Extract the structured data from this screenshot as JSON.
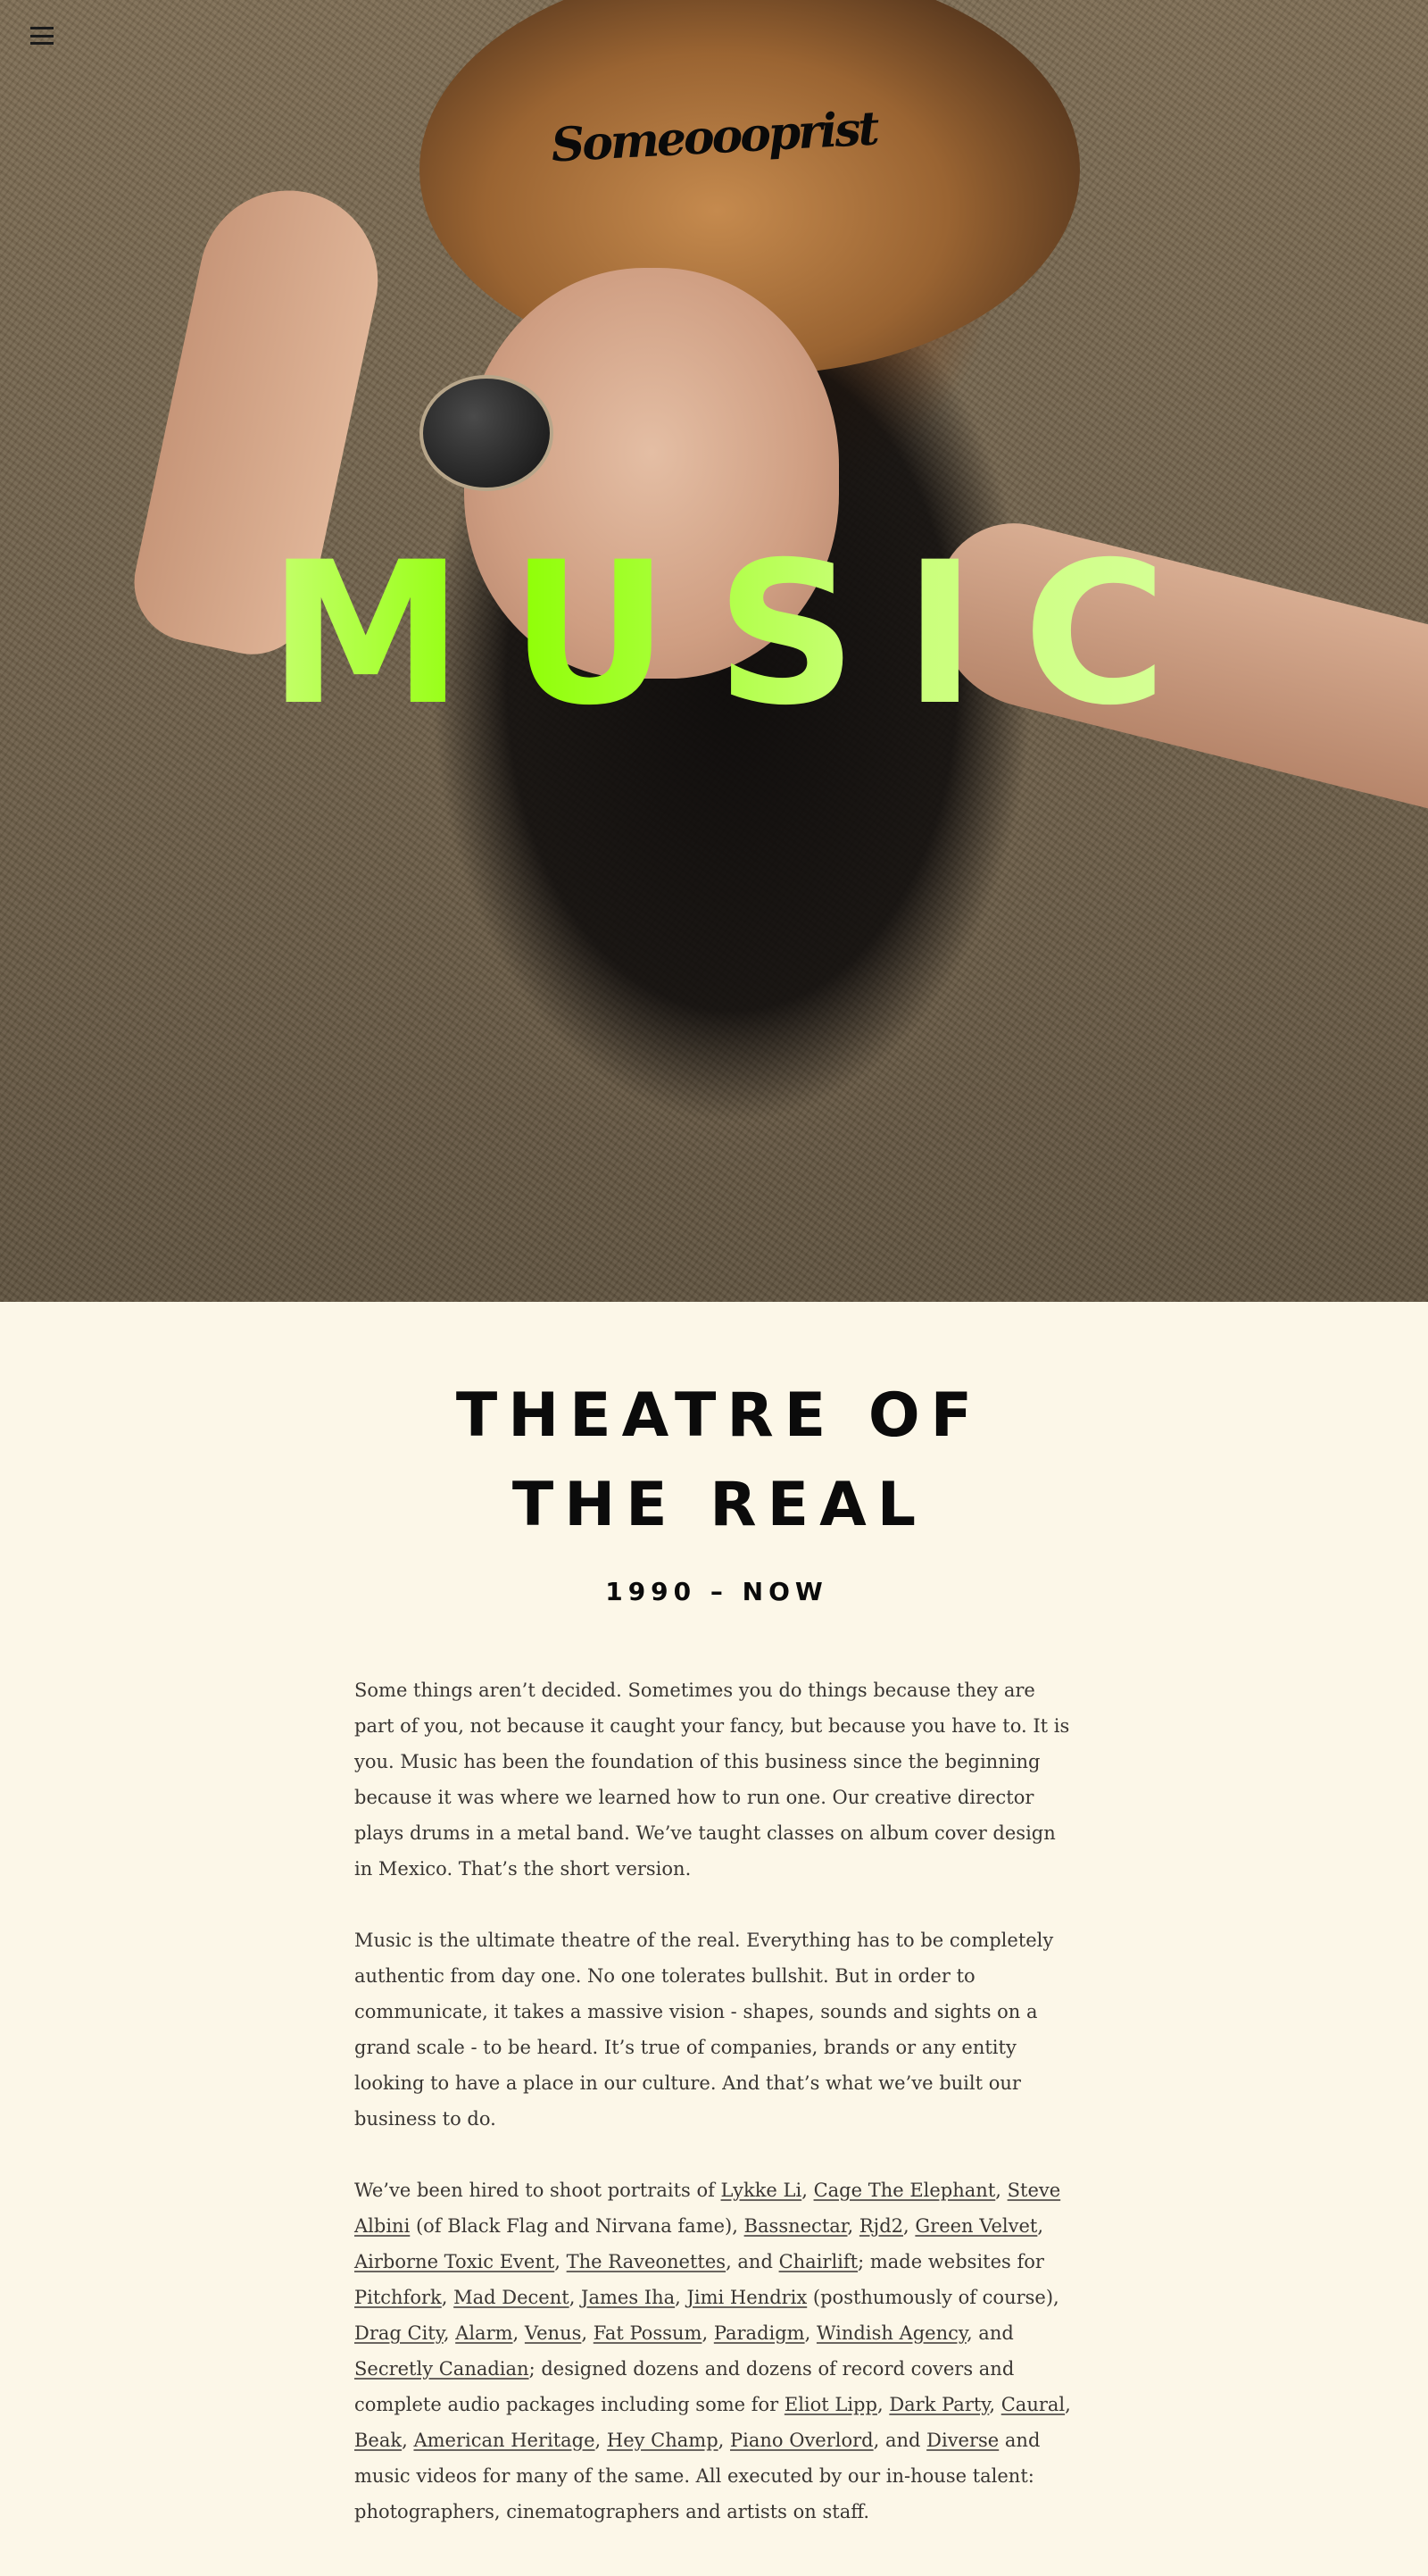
{
  "hero": {
    "logo_text": "Someoooprist",
    "title": "MUSIC",
    "menu_icon": "hamburger-menu-icon"
  },
  "section": {
    "heading_line1": "THEATRE OF",
    "heading_line2": "THE REAL",
    "dates": "1990 – NOW"
  },
  "paragraphs": {
    "p1": "Some things aren’t decided. Sometimes you do things because they are part of you, not because it caught your fancy, but because you have to. It is you. Music has been the foundation of this business since the beginning because it was where we learned how to run one. Our creative director plays drums in a metal band. We’ve taught classes on album cover design in Mexico. That’s the short version.",
    "p2": "Music is the ultimate theatre of the real. Everything has to be completely authentic from day one. No one tolerates bullshit. But in order to communicate, it takes a massive vision - shapes, sounds and sights on a grand scale - to be heard. It’s true of companies, brands or any entity looking to have a place in our culture. And that’s what we’ve built our business to do.",
    "p3": {
      "t0": "We’ve been hired to shoot portraits of ",
      "l_lykke": "Lykke Li",
      "t1": ",  ",
      "l_cage": "Cage The Elephant",
      "t2": ",  ",
      "l_albini": "Steve Albini",
      "t3": " (of Black Flag and Nirvana fame), ",
      "l_bassnectar": "Bassnectar",
      "t4": ", ",
      "l_rjd2": "Rjd2",
      "t5": ", ",
      "l_greenvelvet": "Green Velvet",
      "t6": ", ",
      "l_airborne": "Airborne Toxic Event",
      "t7": ", ",
      "l_raveonettes": "The Raveonettes",
      "t8": ", and ",
      "l_chairlift": "Chairlift",
      "t9": "; made websites for ",
      "l_pitchfork": "Pitchfork",
      "t10": ", ",
      "l_maddecent": "Mad Decent",
      "t11": ", ",
      "l_jamesiha": "James Iha",
      "t12": ", ",
      "l_jimihendrix": "Jimi Hendrix",
      "t13": " (posthumously of course), ",
      "l_dragcity": "Drag City",
      "t14": ", ",
      "l_alarm": "Alarm",
      "t15": ", ",
      "l_venus": "Venus",
      "t16": ", ",
      "l_fatpossum": "Fat Possum",
      "t17": ", ",
      "l_paradigm": "Paradigm",
      "t18": ", ",
      "l_windish": "Windish Agency",
      "t19": ", and ",
      "l_secretly": "Secretly Canadian",
      "t20": "; designed dozens and dozens of record covers and complete audio packages including some for ",
      "l_eliotlipp": "Eliot Lipp",
      "t21": ", ",
      "l_darkparty": "Dark Party",
      "t22": ", ",
      "l_caural": "Caural",
      "t23": ", ",
      "l_beak": "Beak",
      "t24": ", ",
      "l_americanheritage": "American Heritage",
      "t25": ", ",
      "l_heychamp": "Hey Champ",
      "t26": ", ",
      "l_pianooverlord": "Piano Overlord",
      "t27": ", and ",
      "l_diverse": "Diverse",
      "t28": " and music videos for many of the same. All executed by our in-house talent: photographers, cinematographers and artists on staff."
    }
  },
  "colors": {
    "background": "#fcf7e8",
    "title_green": "#8cff00",
    "text": "#3a3633",
    "heading": "#0b0b0b"
  }
}
